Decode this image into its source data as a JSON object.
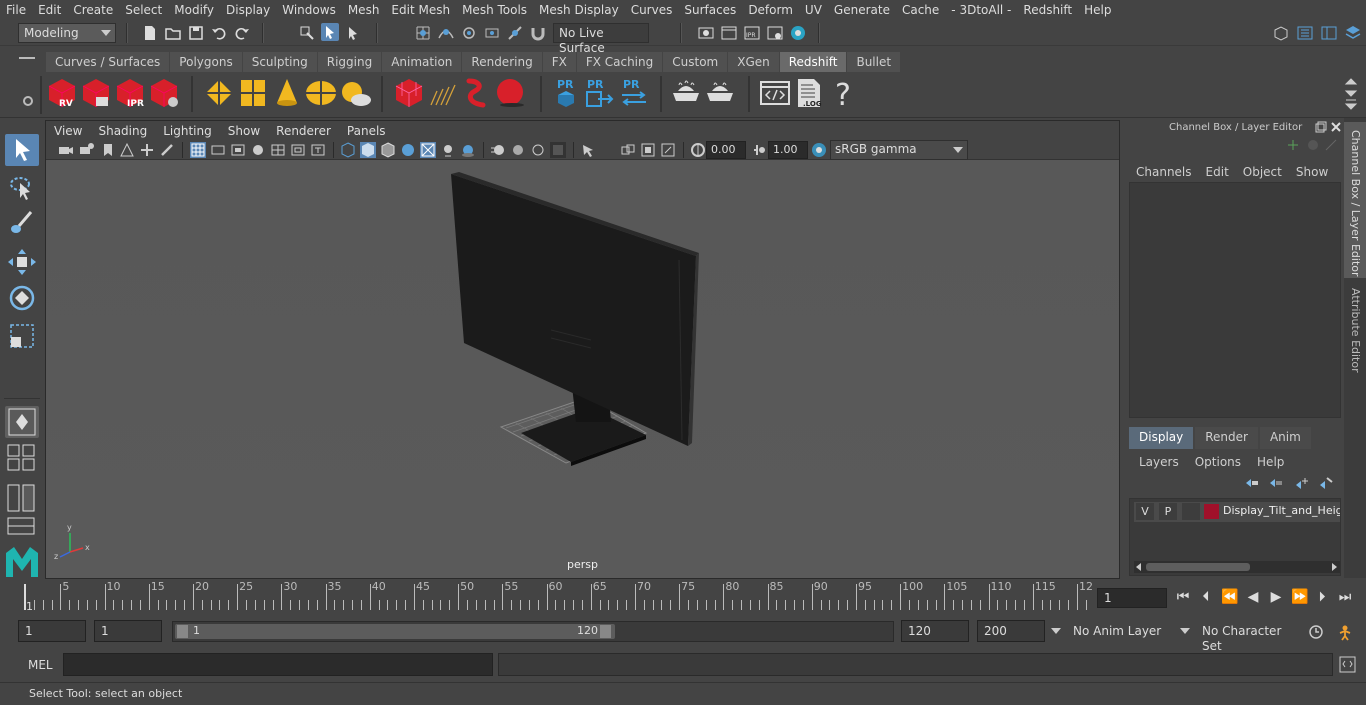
{
  "menu": [
    "File",
    "Edit",
    "Create",
    "Select",
    "Modify",
    "Display",
    "Windows",
    "Mesh",
    "Edit Mesh",
    "Mesh Tools",
    "Mesh Display",
    "Curves",
    "Surfaces",
    "Deform",
    "UV",
    "Generate",
    "Cache",
    "- 3DtoAll -",
    "Redshift",
    "Help"
  ],
  "status": {
    "mode": "Modeling",
    "live_surface": "No Live Surface"
  },
  "shelf_tabs": [
    "Curves / Surfaces",
    "Polygons",
    "Sculpting",
    "Rigging",
    "Animation",
    "Rendering",
    "FX",
    "FX Caching",
    "Custom",
    "XGen",
    "Redshift",
    "Bullet"
  ],
  "active_shelf": "Redshift",
  "shelf_labels": {
    "rv": "RV",
    "ipr": "IPR",
    "pr1": "PR",
    "pr2": "PR",
    "pr3": "PR",
    "log": ".LOG",
    "help": "?"
  },
  "viewport": {
    "menu": [
      "View",
      "Shading",
      "Lighting",
      "Show",
      "Renderer",
      "Panels"
    ],
    "exposure": "0.00",
    "gamma": "1.00",
    "color_space": "sRGB gamma",
    "camera_label": "persp"
  },
  "channel_box": {
    "title": "Channel Box / Layer Editor",
    "menu": [
      "Channels",
      "Edit",
      "Object",
      "Show"
    ]
  },
  "layer_editor": {
    "tabs": [
      "Display",
      "Render",
      "Anim"
    ],
    "active_tab": "Display",
    "menu": [
      "Layers",
      "Options",
      "Help"
    ],
    "layer": {
      "v": "V",
      "p": "P",
      "name": "Display_Tilt_and_Heigl",
      "color": "#a0102a"
    }
  },
  "side_tabs": [
    "Channel Box / Layer Editor",
    "Attribute Editor"
  ],
  "timeline": {
    "ticks": [
      "5",
      "10",
      "15",
      "20",
      "25",
      "30",
      "35",
      "40",
      "45",
      "50",
      "55",
      "60",
      "65",
      "70",
      "75",
      "80",
      "85",
      "90",
      "95",
      "100",
      "105",
      "110",
      "115",
      "12"
    ],
    "start_marker": "1",
    "current_frame": "1"
  },
  "range": {
    "start": "1",
    "playback_start": "1",
    "slider_start": "1",
    "slider_end": "120",
    "playback_end": "120",
    "end": "200",
    "anim_layer": "No Anim Layer",
    "char_set": "No Character Set"
  },
  "cmd": {
    "lang": "MEL"
  },
  "help_text": "Select Tool: select an object",
  "colors": {
    "accent": "#5a9fd6",
    "redshift": "#d8202a",
    "maya_logo": "#1fb5b0"
  }
}
